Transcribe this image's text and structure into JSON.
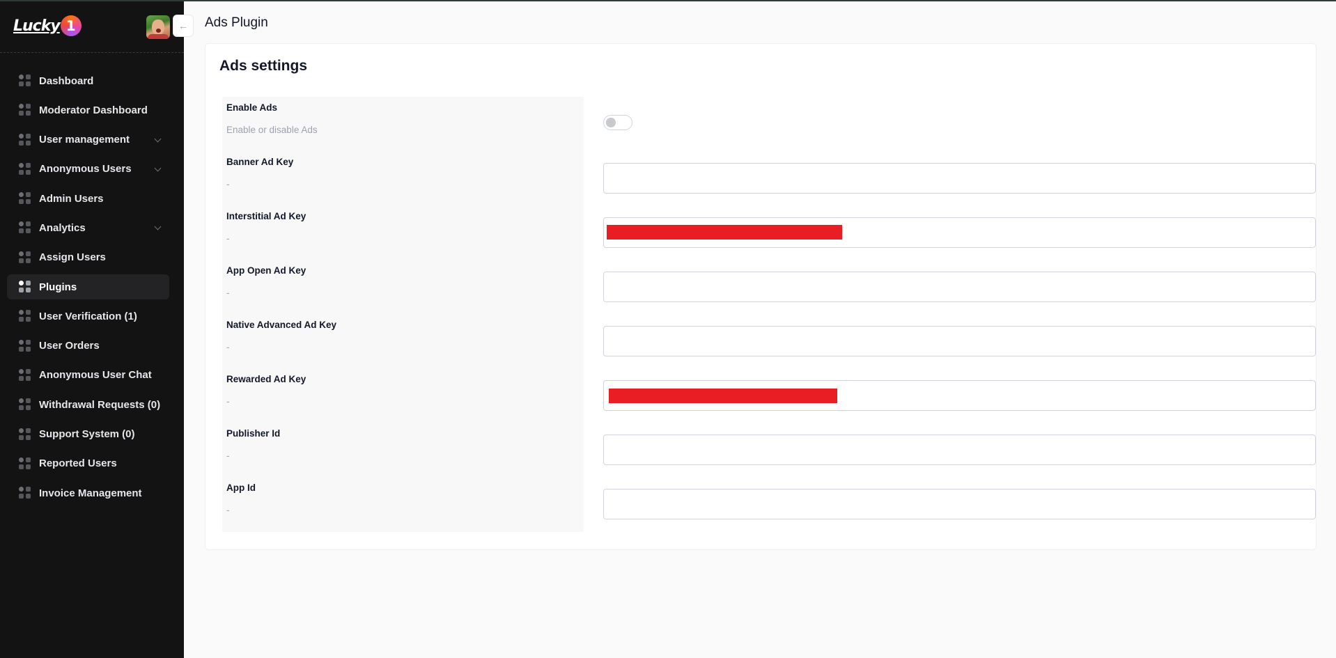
{
  "brand": {
    "name": "Lucky",
    "badge": "1"
  },
  "sidebar": {
    "items": [
      {
        "label": "Dashboard",
        "has_children": false,
        "active": false
      },
      {
        "label": "Moderator Dashboard",
        "has_children": false,
        "active": false
      },
      {
        "label": "User management",
        "has_children": true,
        "active": false
      },
      {
        "label": "Anonymous Users",
        "has_children": true,
        "active": false
      },
      {
        "label": "Admin Users",
        "has_children": false,
        "active": false
      },
      {
        "label": "Analytics",
        "has_children": true,
        "active": false
      },
      {
        "label": "Assign Users",
        "has_children": false,
        "active": false
      },
      {
        "label": "Plugins",
        "has_children": false,
        "active": true
      },
      {
        "label": "User Verification (1)",
        "has_children": false,
        "active": false
      },
      {
        "label": "User Orders",
        "has_children": false,
        "active": false
      },
      {
        "label": "Anonymous User Chat",
        "has_children": false,
        "active": false
      },
      {
        "label": "Withdrawal Requests (0)",
        "has_children": false,
        "active": false
      },
      {
        "label": "Support System (0)",
        "has_children": false,
        "active": false
      },
      {
        "label": "Reported Users",
        "has_children": false,
        "active": false
      },
      {
        "label": "Invoice Management",
        "has_children": false,
        "active": false
      }
    ],
    "collapse_icon": "arrow-left-icon"
  },
  "header": {
    "title": "Ads Plugin"
  },
  "settings": {
    "title": "Ads settings",
    "fields": [
      {
        "label": "Enable Ads",
        "description": "Enable or disable Ads",
        "type": "toggle",
        "enabled": false
      },
      {
        "label": "Banner Ad Key",
        "description": "-",
        "type": "text",
        "value": "",
        "redacted": false
      },
      {
        "label": "Interstitial Ad Key",
        "description": "-",
        "type": "text",
        "value": "",
        "redacted": true
      },
      {
        "label": "App Open Ad Key",
        "description": "-",
        "type": "text",
        "value": "",
        "redacted": false
      },
      {
        "label": "Native Advanced Ad Key",
        "description": "-",
        "type": "text",
        "value": "",
        "redacted": false
      },
      {
        "label": "Rewarded Ad Key",
        "description": "-",
        "type": "text",
        "value": "",
        "redacted": true
      },
      {
        "label": "Publisher Id",
        "description": "-",
        "type": "text",
        "value": "",
        "redacted": false
      },
      {
        "label": "App Id",
        "description": "-",
        "type": "text",
        "value": "",
        "redacted": false
      }
    ]
  },
  "colors": {
    "sidebar_bg": "#131314",
    "redaction": "#e91e25",
    "page_bg": "#fafafa"
  }
}
